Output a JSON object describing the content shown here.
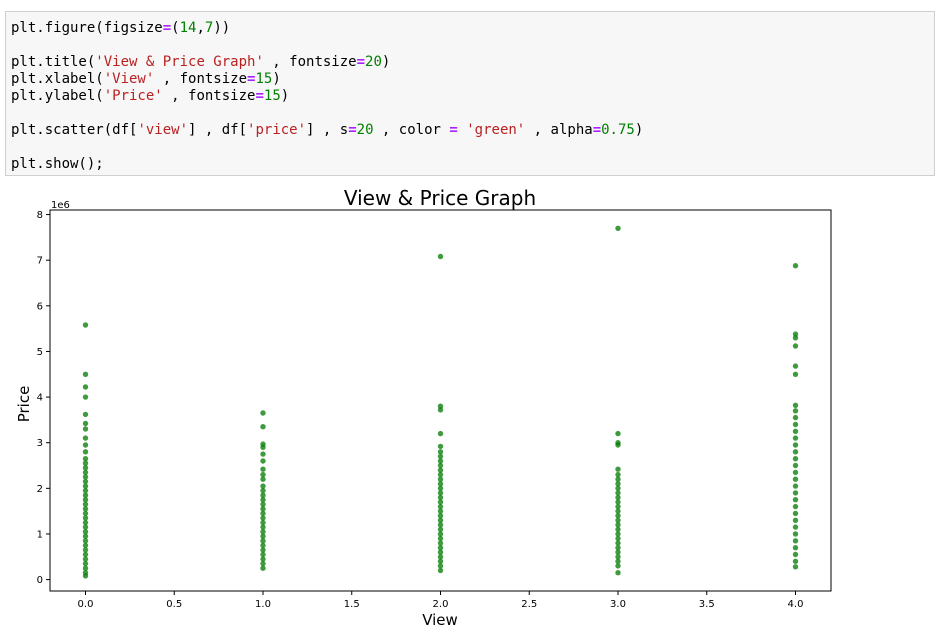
{
  "code_cell": {
    "lines": [
      [
        {
          "t": "plt.figure(figsize",
          "c": "plain"
        },
        {
          "t": "=",
          "c": "op"
        },
        {
          "t": "(",
          "c": "plain"
        },
        {
          "t": "14",
          "c": "num"
        },
        {
          "t": ",",
          "c": "plain"
        },
        {
          "t": "7",
          "c": "num"
        },
        {
          "t": "))",
          "c": "plain"
        }
      ],
      [],
      [
        {
          "t": "plt.title(",
          "c": "plain"
        },
        {
          "t": "'View & Price Graph'",
          "c": "str"
        },
        {
          "t": " , fontsize",
          "c": "plain"
        },
        {
          "t": "=",
          "c": "op"
        },
        {
          "t": "20",
          "c": "num"
        },
        {
          "t": ")",
          "c": "plain"
        }
      ],
      [
        {
          "t": "plt.xlabel(",
          "c": "plain"
        },
        {
          "t": "'View'",
          "c": "str"
        },
        {
          "t": " , fontsize",
          "c": "plain"
        },
        {
          "t": "=",
          "c": "op"
        },
        {
          "t": "15",
          "c": "num"
        },
        {
          "t": ")",
          "c": "plain"
        }
      ],
      [
        {
          "t": "plt.ylabel(",
          "c": "plain"
        },
        {
          "t": "'Price'",
          "c": "str"
        },
        {
          "t": " , fontsize",
          "c": "plain"
        },
        {
          "t": "=",
          "c": "op"
        },
        {
          "t": "15",
          "c": "num"
        },
        {
          "t": ")",
          "c": "plain"
        }
      ],
      [],
      [
        {
          "t": "plt.scatter(df[",
          "c": "plain"
        },
        {
          "t": "'view'",
          "c": "str"
        },
        {
          "t": "] , df[",
          "c": "plain"
        },
        {
          "t": "'price'",
          "c": "str"
        },
        {
          "t": "] , s",
          "c": "plain"
        },
        {
          "t": "=",
          "c": "op"
        },
        {
          "t": "20",
          "c": "num"
        },
        {
          "t": " , color ",
          "c": "plain"
        },
        {
          "t": "=",
          "c": "op"
        },
        {
          "t": " ",
          "c": "plain"
        },
        {
          "t": "'green'",
          "c": "str"
        },
        {
          "t": " , alpha",
          "c": "plain"
        },
        {
          "t": "=",
          "c": "op"
        },
        {
          "t": "0.75",
          "c": "num"
        },
        {
          "t": ")",
          "c": "plain"
        }
      ],
      [],
      [
        {
          "t": "plt.show();",
          "c": "plain"
        }
      ]
    ]
  },
  "chart_data": {
    "type": "scatter",
    "title": "View & Price Graph",
    "xlabel": "View",
    "ylabel": "Price",
    "y_scale_label": "1e6",
    "xlim": [
      -0.2,
      4.2
    ],
    "ylim": [
      -0.25,
      8.1
    ],
    "x_ticks": [
      0.0,
      0.5,
      1.0,
      1.5,
      2.0,
      2.5,
      3.0,
      3.5,
      4.0
    ],
    "x_tick_labels": [
      "0.0",
      "0.5",
      "1.0",
      "1.5",
      "2.0",
      "2.5",
      "3.0",
      "3.5",
      "4.0"
    ],
    "y_ticks": [
      0,
      1,
      2,
      3,
      4,
      5,
      6,
      7,
      8
    ],
    "y_tick_labels": [
      "0",
      "1",
      "2",
      "3",
      "4",
      "5",
      "6",
      "7",
      "8"
    ],
    "grid": false,
    "marker_color": "#007a00",
    "marker_alpha": 0.75,
    "points": [
      {
        "x": 0,
        "y": [
          0.08,
          0.15,
          0.25,
          0.35,
          0.45,
          0.55,
          0.65,
          0.75,
          0.85,
          0.95,
          1.05,
          1.15,
          1.25,
          1.35,
          1.45,
          1.55,
          1.65,
          1.75,
          1.85,
          1.95,
          2.05,
          2.15,
          2.25,
          2.35,
          2.45,
          2.55,
          2.65,
          2.8,
          2.95,
          3.1,
          3.3,
          3.42,
          3.62,
          4.0,
          4.22,
          4.5,
          5.58
        ]
      },
      {
        "x": 1,
        "y": [
          0.25,
          0.35,
          0.45,
          0.55,
          0.65,
          0.75,
          0.85,
          0.95,
          1.05,
          1.15,
          1.25,
          1.35,
          1.45,
          1.55,
          1.65,
          1.75,
          1.85,
          1.95,
          2.05,
          2.2,
          2.3,
          2.42,
          2.6,
          2.75,
          2.9,
          2.97,
          3.35,
          3.65
        ]
      },
      {
        "x": 2,
        "y": [
          0.2,
          0.3,
          0.4,
          0.5,
          0.6,
          0.7,
          0.8,
          0.9,
          1.0,
          1.1,
          1.2,
          1.3,
          1.4,
          1.5,
          1.6,
          1.7,
          1.8,
          1.9,
          2.0,
          2.1,
          2.2,
          2.3,
          2.4,
          2.5,
          2.6,
          2.7,
          2.8,
          2.92,
          3.2,
          3.72,
          3.8,
          7.08
        ]
      },
      {
        "x": 3,
        "y": [
          0.15,
          0.3,
          0.4,
          0.5,
          0.6,
          0.7,
          0.8,
          0.9,
          1.0,
          1.1,
          1.2,
          1.3,
          1.4,
          1.5,
          1.6,
          1.7,
          1.8,
          1.9,
          2.0,
          2.1,
          2.2,
          2.3,
          2.42,
          2.95,
          3.0,
          3.2,
          7.7
        ]
      },
      {
        "x": 4,
        "y": [
          0.28,
          0.4,
          0.55,
          0.7,
          0.85,
          1.0,
          1.15,
          1.3,
          1.45,
          1.6,
          1.75,
          1.9,
          2.05,
          2.2,
          2.35,
          2.5,
          2.65,
          2.8,
          2.95,
          3.1,
          3.25,
          3.4,
          3.55,
          3.7,
          3.82,
          4.5,
          4.68,
          5.12,
          5.3,
          5.38,
          6.88
        ]
      }
    ]
  }
}
